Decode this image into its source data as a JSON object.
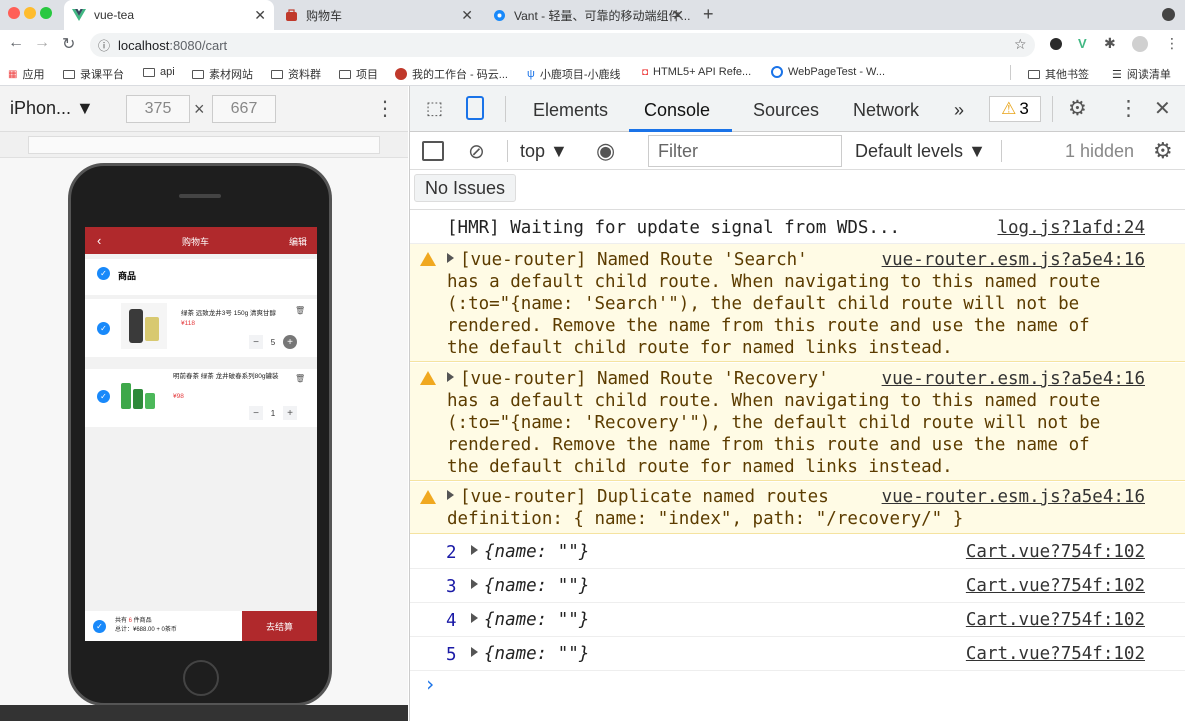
{
  "browser": {
    "tabs": [
      {
        "title": "vue-tea",
        "icon": "vue-logo-icon",
        "active": true
      },
      {
        "title": "购物车",
        "icon": "cart-favicon-icon",
        "active": false
      },
      {
        "title": "Vant - 轻量、可靠的移动端组件...",
        "icon": "vant-logo-icon",
        "active": false
      }
    ],
    "url_host": "localhost",
    "url_rest": ":8080/cart",
    "bookmarks": [
      "应用",
      "录课平台",
      "api",
      "素材网站",
      "资料群",
      "项目",
      "我的工作台 - 码云...",
      "小鹿项目-小鹿线",
      "HTML5+ API Refe...",
      "WebPageTest - W..."
    ],
    "bookmarks_right": [
      "其他书签",
      "阅读清单"
    ]
  },
  "device": {
    "name": "iPhon...",
    "width": "375",
    "height": "667",
    "times": "×"
  },
  "app": {
    "back": "‹",
    "title": "购物车",
    "edit": "编辑",
    "section": "商品",
    "items": [
      {
        "name": "绿茶 远致龙井3号 150g 清爽甘醇",
        "price": "¥118",
        "qty": "5"
      },
      {
        "name": "明前春茶 绿茶 龙井破春系列80g罐装",
        "price": "¥98",
        "qty": "1"
      }
    ],
    "summary_line1_a": "共有 ",
    "summary_count": "6",
    "summary_line1_b": " 件商品",
    "summary_line2": "总计：¥688.00 + 0茶币",
    "checkout": "去结算"
  },
  "devtools": {
    "tabs": [
      "Elements",
      "Console",
      "Sources",
      "Network"
    ],
    "active_tab": "Console",
    "more": "»",
    "warnings_count": "3",
    "context": "top",
    "filter_placeholder": "Filter",
    "levels": "Default levels",
    "hidden": "1 hidden",
    "no_issues": "No Issues",
    "messages": [
      {
        "type": "log",
        "lines": [
          "[HMR] Waiting for update signal from WDS..."
        ],
        "source": "log.js?1afd:24"
      },
      {
        "type": "warn",
        "lines": [
          "[vue-router] Named Route 'Search'",
          "has a default child route. When navigating to this named route",
          "(:to=\"{name: 'Search'\"), the default child route will not be",
          "rendered. Remove the name from this route and use the name of",
          "the default child route for named links instead."
        ],
        "source": "vue-router.esm.js?a5e4:16"
      },
      {
        "type": "warn",
        "lines": [
          "[vue-router] Named Route 'Recovery'",
          "has a default child route. When navigating to this named route",
          "(:to=\"{name: 'Recovery'\"), the default child route will not be",
          "rendered. Remove the name from this route and use the name of",
          "the default child route for named links instead."
        ],
        "source": "vue-router.esm.js?a5e4:16"
      },
      {
        "type": "warn",
        "lines": [
          "[vue-router] Duplicate named routes",
          "definition: { name: \"index\", path: \"/recovery/\" }"
        ],
        "source": "vue-router.esm.js?a5e4:16"
      },
      {
        "type": "obj",
        "count": "2",
        "text": "{name: \"\"}",
        "source": "Cart.vue?754f:102"
      },
      {
        "type": "obj",
        "count": "3",
        "text": "{name: \"\"}",
        "source": "Cart.vue?754f:102"
      },
      {
        "type": "obj",
        "count": "4",
        "text": "{name: \"\"}",
        "source": "Cart.vue?754f:102"
      },
      {
        "type": "obj",
        "count": "5",
        "text": "{name: \"\"}",
        "source": "Cart.vue?754f:102"
      }
    ],
    "prompt": "›"
  },
  "colors": {
    "app_red": "#b0292c",
    "check_blue": "#1989fa",
    "warn_bg": "#fffbe5",
    "link_blue": "#1a73e8"
  }
}
